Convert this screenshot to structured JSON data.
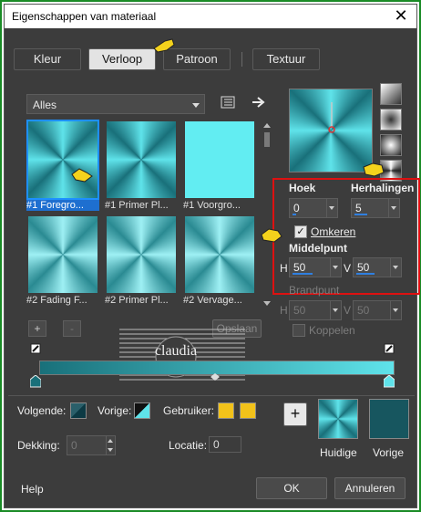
{
  "window": {
    "title": "Eigenschappen van materiaal",
    "close_symbol": "✕"
  },
  "tabs": [
    {
      "label": "Kleur"
    },
    {
      "label": "Verloop"
    },
    {
      "label": "Patroon"
    },
    {
      "label": "Textuur"
    }
  ],
  "category_dropdown": {
    "value": "Alles"
  },
  "gradients": [
    {
      "label": "#1 Foregro..."
    },
    {
      "label": "#1 Primer Pl..."
    },
    {
      "label": "#1 Voorgro..."
    },
    {
      "label": "#2 Fading F..."
    },
    {
      "label": "#2 Primer Pl..."
    },
    {
      "label": "#2 Vervage..."
    }
  ],
  "settings": {
    "hoek_label": "Hoek",
    "hoek_value": "0",
    "herhalingen_label": "Herhalingen",
    "herhalingen_value": "5",
    "omkeren_label": "Omkeren",
    "omkeren_checked": true,
    "middelpunt_label": "Middelpunt",
    "middelpunt_h_label": "H",
    "middelpunt_h_value": "50",
    "middelpunt_v_label": "V",
    "middelpunt_v_value": "50",
    "brandpunt_label": "Brandpunt",
    "brandpunt_h_label": "H",
    "brandpunt_h_value": "50",
    "brandpunt_v_label": "V",
    "brandpunt_v_value": "50",
    "koppelen_label": "Koppelen",
    "koppelen_checked": false
  },
  "editor": {
    "add_symbol": "+",
    "remove_symbol": "-",
    "opslaan_label": "Opslaan"
  },
  "watermark": {
    "text": "claudia"
  },
  "bottom": {
    "volgende_label": "Volgende:",
    "vorige_label": "Vorige:",
    "gebruiker_label": "Gebruiker:",
    "dekking_label": "Dekking:",
    "dekking_value": "0",
    "locatie_label": "Locatie:",
    "locatie_value": "0",
    "plus_symbol": "+",
    "huidige_label": "Huidige",
    "vorige_swatch_label": "Vorige"
  },
  "footer": {
    "help_label": "Help",
    "ok_label": "OK",
    "cancel_label": "Annuleren"
  },
  "colors": {
    "teal_dark": "#19707a",
    "teal_light": "#5fe3ea",
    "selection_blue": "#1e6fd0",
    "highlight_red": "#d11111",
    "user_yellow": "#f2c21a",
    "vorige_swatch": "#17565f"
  }
}
